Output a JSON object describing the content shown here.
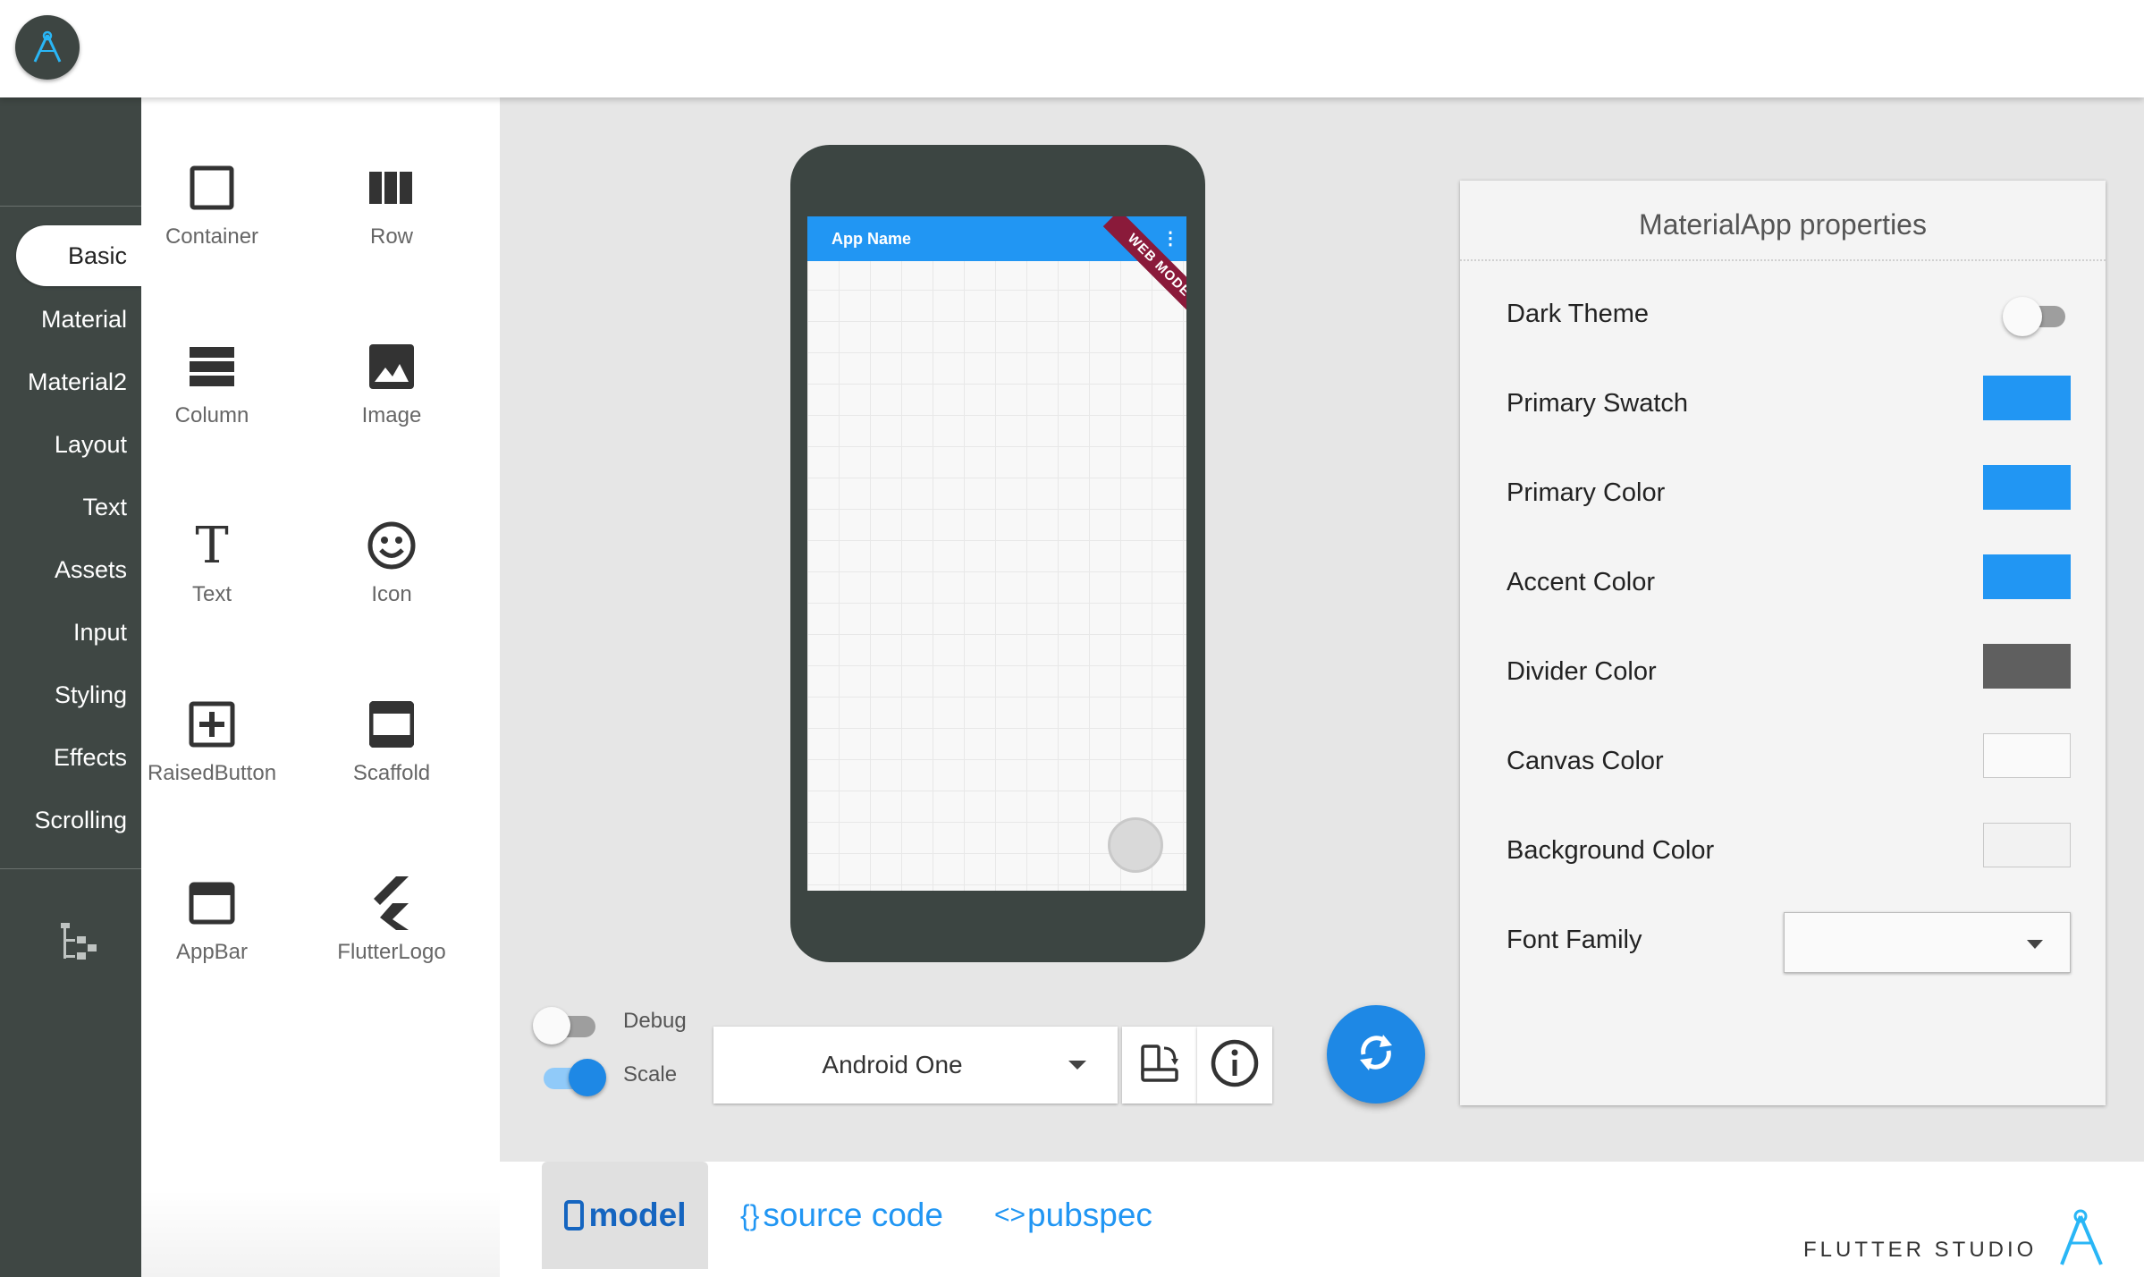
{
  "header": {
    "logo_icon": "flutter-studio-logo-icon"
  },
  "categories": {
    "items": [
      {
        "label": "Basic",
        "active": true
      },
      {
        "label": "Material"
      },
      {
        "label": "Material2"
      },
      {
        "label": "Layout"
      },
      {
        "label": "Text"
      },
      {
        "label": "Assets"
      },
      {
        "label": "Input"
      },
      {
        "label": "Styling"
      },
      {
        "label": "Effects"
      },
      {
        "label": "Scrolling"
      }
    ],
    "tree_icon": "widget-tree-icon"
  },
  "palette": {
    "widgets": [
      {
        "label": "Container",
        "icon": "container-icon"
      },
      {
        "label": "Row",
        "icon": "row-icon"
      },
      {
        "label": "Column",
        "icon": "column-icon"
      },
      {
        "label": "Image",
        "icon": "image-icon"
      },
      {
        "label": "Text",
        "icon": "text-icon"
      },
      {
        "label": "Icon",
        "icon": "smiley-icon"
      },
      {
        "label": "RaisedButton",
        "icon": "add-box-icon"
      },
      {
        "label": "Scaffold",
        "icon": "scaffold-icon"
      },
      {
        "label": "AppBar",
        "icon": "appbar-icon"
      },
      {
        "label": "FlutterLogo",
        "icon": "flutter-logo-icon"
      }
    ]
  },
  "preview": {
    "app_name": "App Name",
    "banner": "WEB MODE",
    "menu_glyph": "⋮"
  },
  "controls": {
    "debug_label": "Debug",
    "debug_on": false,
    "scale_label": "Scale",
    "scale_on": true,
    "device": "Android One",
    "rotate_icon": "rotate-device-icon",
    "info_icon": "info-icon",
    "refresh_icon": "refresh-icon"
  },
  "properties": {
    "title": "MaterialApp properties",
    "dark_theme_label": "Dark Theme",
    "dark_theme_on": false,
    "colors": [
      {
        "label": "Primary Swatch",
        "color": "#2196f3"
      },
      {
        "label": "Primary Color",
        "color": "#2196f3"
      },
      {
        "label": "Accent Color",
        "color": "#2196f3"
      },
      {
        "label": "Divider Color",
        "color": "#5f5f5f"
      },
      {
        "label": "Canvas Color",
        "color": "#fafafa"
      },
      {
        "label": "Background Color",
        "color": "#f2f2f2"
      }
    ],
    "font_family_label": "Font Family",
    "font_family_value": ""
  },
  "tabs": [
    {
      "label": "model",
      "icon": "phone-icon",
      "active": true
    },
    {
      "label": "source code",
      "icon": "braces-icon"
    },
    {
      "label": "pubspec",
      "icon": "code-icon"
    }
  ],
  "brand": "FLUTTER STUDIO",
  "brand_icon": "flutter-studio-logo-icon"
}
